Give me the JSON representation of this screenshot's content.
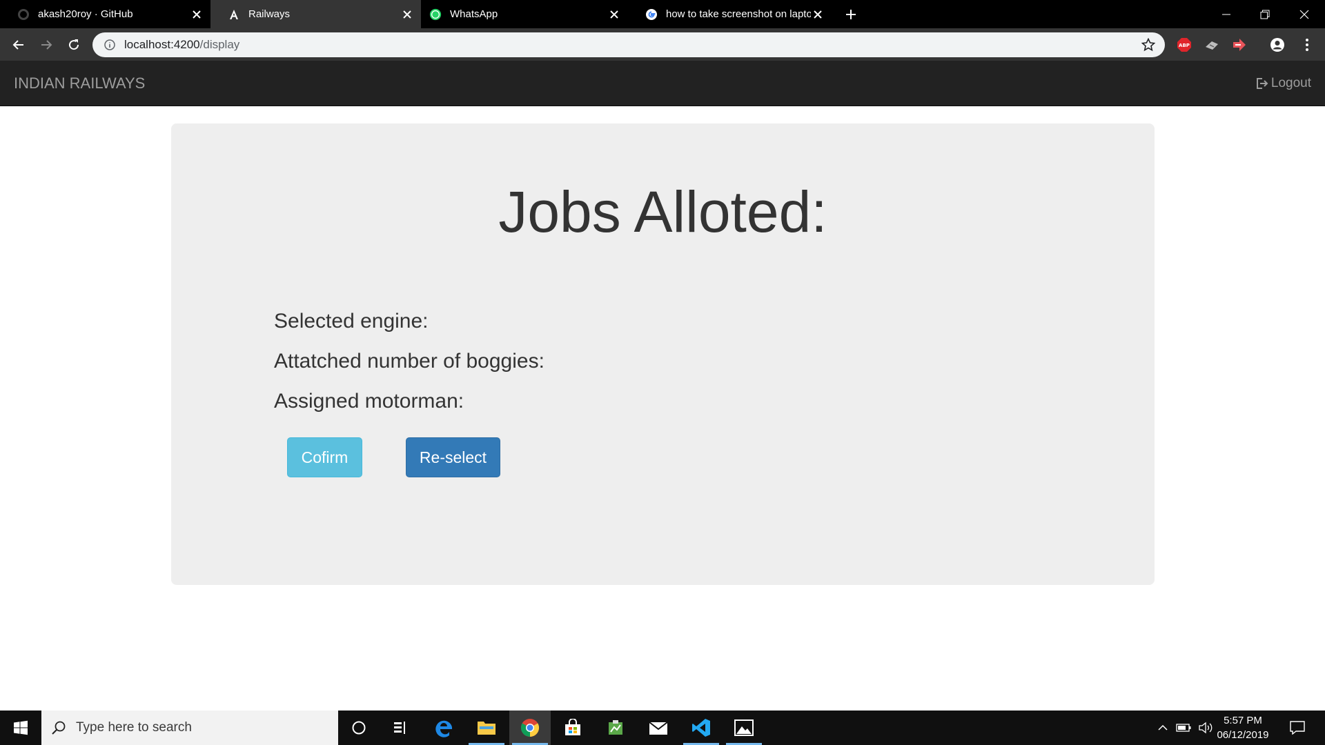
{
  "browser": {
    "tabs": [
      {
        "title": "akash20roy · GitHub",
        "icon": "github-icon",
        "active": false
      },
      {
        "title": "Railways",
        "icon": "angular-icon",
        "active": true
      },
      {
        "title": "WhatsApp",
        "icon": "whatsapp-icon",
        "active": false
      },
      {
        "title": "how to take screenshot on laptop",
        "icon": "google-icon",
        "active": false
      }
    ],
    "address": {
      "host": "localhost:4200",
      "path": "/display"
    }
  },
  "navbar": {
    "brand": "INDIAN RAILWAYS",
    "logout_label": "Logout"
  },
  "panel": {
    "heading": "Jobs Alloted:",
    "fields": [
      {
        "label": "Selected engine:"
      },
      {
        "label": "Attatched number of boggies:"
      },
      {
        "label": "Assigned motorman:"
      }
    ],
    "confirm_label": "Cofirm",
    "reselect_label": "Re-select"
  },
  "taskbar": {
    "search_placeholder": "Type here to search",
    "time": "5:57 PM",
    "date": "06/12/2019"
  },
  "colors": {
    "navbar_bg": "#222222",
    "panel_bg": "#eeeeee",
    "confirm_btn": "#5bc0de",
    "reselect_btn": "#337ab7"
  }
}
